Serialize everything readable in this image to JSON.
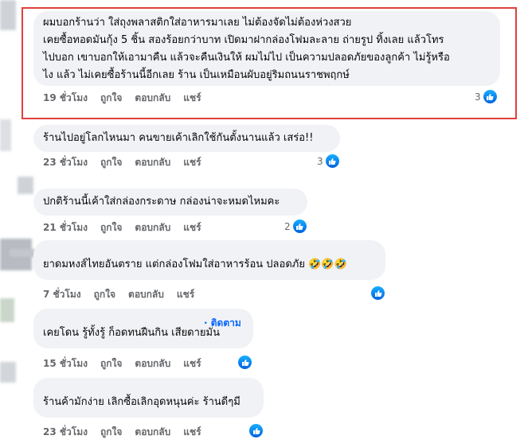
{
  "comments": [
    {
      "text": "ผมบอกร้านว่า ใส่ถุงพลาสติกใส่อาหารมาเลย ไม่ต้องจัดไม่ต้องห่วงสวย\nเคยซื้อทอดมันกุ้ง 5 ชิ้น สองร้อยกว่าบาท เปิดมาฝากล่องโฟมละลาย ถ่ายรูป ทิ้งเลย แล้วโทร\nไปบอก เขาบอกให้เอามาคืน แล้วจะคืนเงินให้ ผมไม่ไป เป็นความปลอดภัยของลูกค้า ไม่รู้หรือ\nไง แล้ว ไม่เคยซื้อร้านนี้อีกเลย ร้าน เป็นเหมือนผับอยู่ริมถนนราชพฤกษ์",
      "time": "19 ชั่วโมง",
      "like": "ถูกใจ",
      "reply": "ตอบกลับ",
      "share": "แชร์",
      "reactions": "3"
    },
    {
      "text": "ร้านไปอยู่โลกไหนมา คนขายเค้าเลิกใช้กันตั้งนานแล้ว เสร่อ!!",
      "time": "23 ชั่วโมง",
      "like": "ถูกใจ",
      "reply": "ตอบกลับ",
      "share": "แชร์",
      "reactions": "3"
    },
    {
      "text": "ปกติร้านนี้เค้าใส่กล่องกระดาษ กล่องน่าจะหมดไหมคะ",
      "time": "21 ชั่วโมง",
      "like": "ถูกใจ",
      "reply": "ตอบกลับ",
      "share": "แชร์",
      "reactions": "2"
    },
    {
      "text": "ยาดมหงส์ไทยอันตราย แต่กล่องโฟมใส่อาหารร้อน ปลอดภัย 🤣🤣🤣",
      "time": "7 ชั่วโมง",
      "like": "ถูกใจ",
      "reply": "ตอบกลับ",
      "share": "แชร์",
      "reactions": ""
    },
    {
      "follow": "· ติดตาม",
      "text": "เคยโดน รู้ทั้งรู้ ก็อดทนฝืนกิน เสียดายมัน",
      "time": "15 ชั่วโมง",
      "like": "ถูกใจ",
      "reply": "ตอบกลับ",
      "share": "แชร์",
      "reactions": ""
    },
    {
      "text": "ร้านค้ามักง่าย เลิกซื้อเลิกอุดหนุนค่ะ ร้านดีๆมี",
      "time": "23 ชั่วโมง",
      "like": "ถูกใจ",
      "reply": "ตอบกลับ",
      "share": "แชร์",
      "reactions": ""
    }
  ],
  "colors": {
    "highlight": "#e0403c",
    "bubble": "#f0f2f5",
    "like": "#0866ff"
  },
  "icons": {
    "like": "thumbs-up-icon"
  }
}
